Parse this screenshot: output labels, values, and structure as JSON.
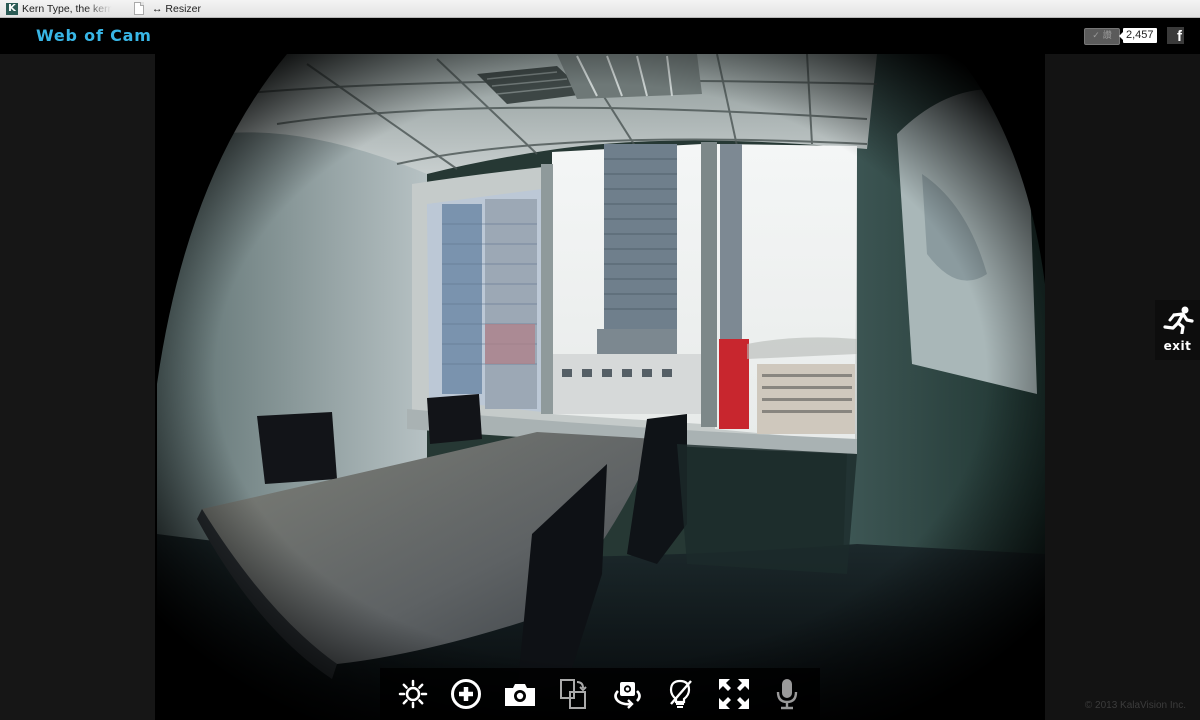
{
  "browser": {
    "bookmarks": [
      {
        "icon": "kern-type-favicon",
        "icon_letter": "K",
        "label": "Kern Type, the kerning game"
      },
      {
        "icon": "document-icon",
        "label": "↔ Resizer"
      }
    ]
  },
  "header": {
    "logo": "Web of Cam",
    "like_button_label": "✓ 讚",
    "like_count": "2,457",
    "facebook_label": "f"
  },
  "camera": {
    "description": "Live fisheye camera view of an office meeting room with a table, chairs, and city-view windows"
  },
  "exit": {
    "label": "exit"
  },
  "toolbar": {
    "buttons": [
      {
        "name": "brightness",
        "icon": "sun-icon"
      },
      {
        "name": "zoom-in",
        "icon": "plus-circle-icon"
      },
      {
        "name": "snapshot",
        "icon": "camera-icon"
      },
      {
        "name": "rotate-view",
        "icon": "rotate-frame-icon"
      },
      {
        "name": "switch-camera",
        "icon": "camera-switch-icon"
      },
      {
        "name": "light-off",
        "icon": "lightbulb-off-icon"
      },
      {
        "name": "fullscreen",
        "icon": "expand-icon"
      },
      {
        "name": "microphone",
        "icon": "microphone-icon"
      }
    ]
  },
  "footer": {
    "copyright": "© 2013 KalaVision Inc."
  },
  "colors": {
    "logo": "#38b6e6",
    "header_bg": "#000000",
    "side_panel_bg": "#161616"
  }
}
